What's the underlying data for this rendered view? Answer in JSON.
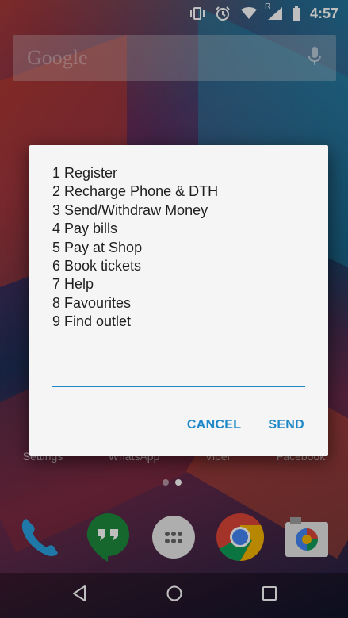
{
  "status_bar": {
    "time": "4:57",
    "icons": [
      "vibrate-icon",
      "alarm-icon",
      "wifi-icon",
      "cell-signal-icon",
      "battery-icon"
    ],
    "roaming_label": "R"
  },
  "search_widget": {
    "label": "Google",
    "mic_icon": "mic-icon"
  },
  "home": {
    "app_labels": [
      "Settings",
      "WhatsApp",
      "Viber",
      "Facebook"
    ],
    "dock_apps": [
      "phone-icon",
      "hangouts-icon",
      "app-drawer-icon",
      "chrome-icon",
      "camera-icon"
    ]
  },
  "dialog": {
    "menu_items": [
      "1 Register",
      "2 Recharge Phone & DTH",
      "3 Send/Withdraw Money",
      "4 Pay bills",
      "5 Pay at Shop",
      "6 Book tickets",
      "7 Help",
      "8 Favourites",
      "9 Find outlet"
    ],
    "input_value": "",
    "cancel_label": "CANCEL",
    "send_label": "SEND"
  },
  "nav": {
    "back": "back-icon",
    "home": "home-icon",
    "recents": "recents-icon"
  },
  "colors": {
    "accent": "#1e88c8",
    "dialog_bg": "#f5f5f5",
    "text": "#1f1f1f"
  }
}
